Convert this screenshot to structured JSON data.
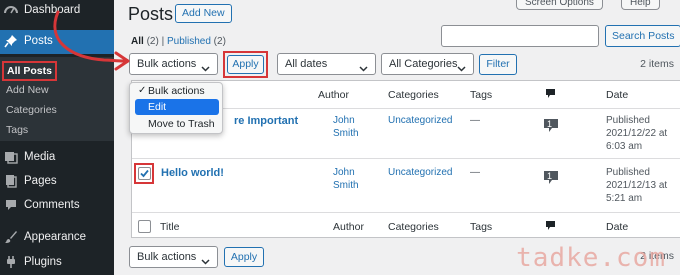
{
  "sidebar": {
    "dashboard": "Dashboard",
    "posts": "Posts",
    "submenu": [
      "All Posts",
      "Add New",
      "Categories",
      "Tags"
    ],
    "media": "Media",
    "pages": "Pages",
    "comments": "Comments",
    "appearance": "Appearance",
    "plugins": "Plugins"
  },
  "header": {
    "title": "Posts",
    "add_new": "Add New",
    "screen_options": "Screen Options",
    "help": "Help"
  },
  "filters": {
    "all_label": "All",
    "all_count": "(2)",
    "separator": "|",
    "published_label": "Published",
    "published_count": "(2)"
  },
  "search": {
    "value": "",
    "button": "Search Posts"
  },
  "toolbar": {
    "bulk_actions": "Bulk actions",
    "apply": "Apply",
    "dates": "All dates",
    "categories": "All Categories",
    "filter": "Filter",
    "items": "2 items"
  },
  "bulk_menu": {
    "options": [
      "Bulk actions",
      "Edit",
      "Move to Trash"
    ],
    "checked_index": 0,
    "highlighted_index": 1
  },
  "table": {
    "columns": {
      "title": "Title",
      "author": "Author",
      "categories": "Categories",
      "tags": "Tags",
      "date": "Date"
    },
    "rows": [
      {
        "title": "re Important",
        "author_line1": "John",
        "author_line2": "Smith",
        "category": "Uncategorized",
        "tags": "—",
        "comments": "1",
        "date_status": "Published",
        "date": "2021/12/22 at",
        "time": "6:03 am",
        "checked": false
      },
      {
        "title": "Hello world!",
        "author_line1": "John",
        "author_line2": "Smith",
        "category": "Uncategorized",
        "tags": "—",
        "comments": "1",
        "date_status": "Published",
        "date": "2021/12/13 at",
        "time": "5:21 am",
        "checked": true
      }
    ]
  },
  "footer_toolbar": {
    "bulk_actions": "Bulk actions",
    "apply": "Apply",
    "items": "2 items"
  },
  "watermark": "tadke.com",
  "colors": {
    "admin_blue": "#2271b1",
    "sidebar_bg": "#1d2327",
    "highlight_red": "#d63638"
  }
}
